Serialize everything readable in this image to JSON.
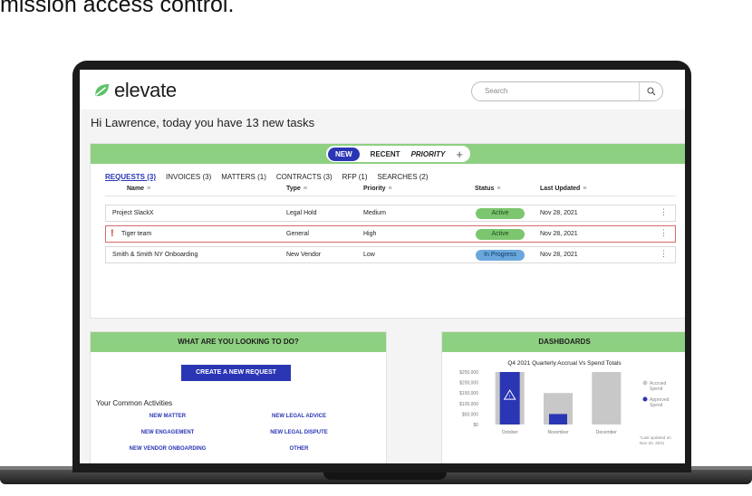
{
  "caption": "mission access control.",
  "app": {
    "logo_text": "elevate",
    "search_placeholder": "Search"
  },
  "greeting": "Hi Lawrence, today you have 13 new tasks",
  "view_tabs": {
    "new": "NEW",
    "recent": "RECENT",
    "priority": "PRIORITY",
    "add": "+"
  },
  "subtabs": [
    "REQUESTS (3)",
    "INVOICES (3)",
    "MATTERS (1)",
    "CONTRACTS (3)",
    "RFP (1)",
    "SEARCHES (2)"
  ],
  "table": {
    "columns": [
      "Name",
      "Type",
      "Priority",
      "Status",
      "Last Updated"
    ],
    "filter_glyph": "≡",
    "rows": [
      {
        "name": "Project SlackX",
        "type": "Legal Hold",
        "priority": "Medium",
        "status": "Active",
        "updated": "Nov 28, 2021",
        "flag": ""
      },
      {
        "name": "Tiger team",
        "type": "General",
        "priority": "High",
        "status": "Active",
        "updated": "Nov 28, 2021",
        "flag": "!"
      },
      {
        "name": "Smith & Smith NY Onboarding",
        "type": "New Vendor",
        "priority": "Low",
        "status": "In Progress",
        "updated": "Nov 28, 2021",
        "flag": ""
      }
    ],
    "kebab_glyph": "⋮"
  },
  "actions_card": {
    "title": "WHAT ARE YOU LOOKING TO DO?",
    "create_label": "CREATE A NEW REQUEST",
    "common_label": "Your Common Activities",
    "items": [
      "NEW MATTER",
      "NEW LEGAL ADVICE",
      "NEW ENGAGEMENT",
      "NEW LEGAL DISPUTE",
      "NEW VENDOR ONBOARDING",
      "OTHER"
    ]
  },
  "dashboards": {
    "title": "DASHBOARDS",
    "note": "*Last updated on Nov 20, 2021"
  },
  "chart_data": {
    "type": "bar",
    "title": "Q4 2021 Quarterly Accrual Vs Spend Totals",
    "categories": [
      "October",
      "November",
      "December"
    ],
    "series": [
      {
        "name": "Accrued Spend",
        "values": [
          250000,
          150000,
          250000
        ],
        "color": "#c8c8c8"
      },
      {
        "name": "Approved Spend",
        "values": [
          250000,
          50000,
          0
        ],
        "color": "#2b36b5"
      }
    ],
    "yticks": [
      "$250,000",
      "$200,000",
      "$150,000",
      "$100,000",
      "$50,000",
      "$0"
    ],
    "ylim": [
      0,
      250000
    ],
    "legend": "right",
    "warning_category": "October"
  },
  "colors": {
    "brand_blue": "#2b36b5",
    "header_green": "#8ed081",
    "active_green": "#7cc66f",
    "progress_blue": "#6aa7dc",
    "alert_red": "#d63a3a"
  }
}
